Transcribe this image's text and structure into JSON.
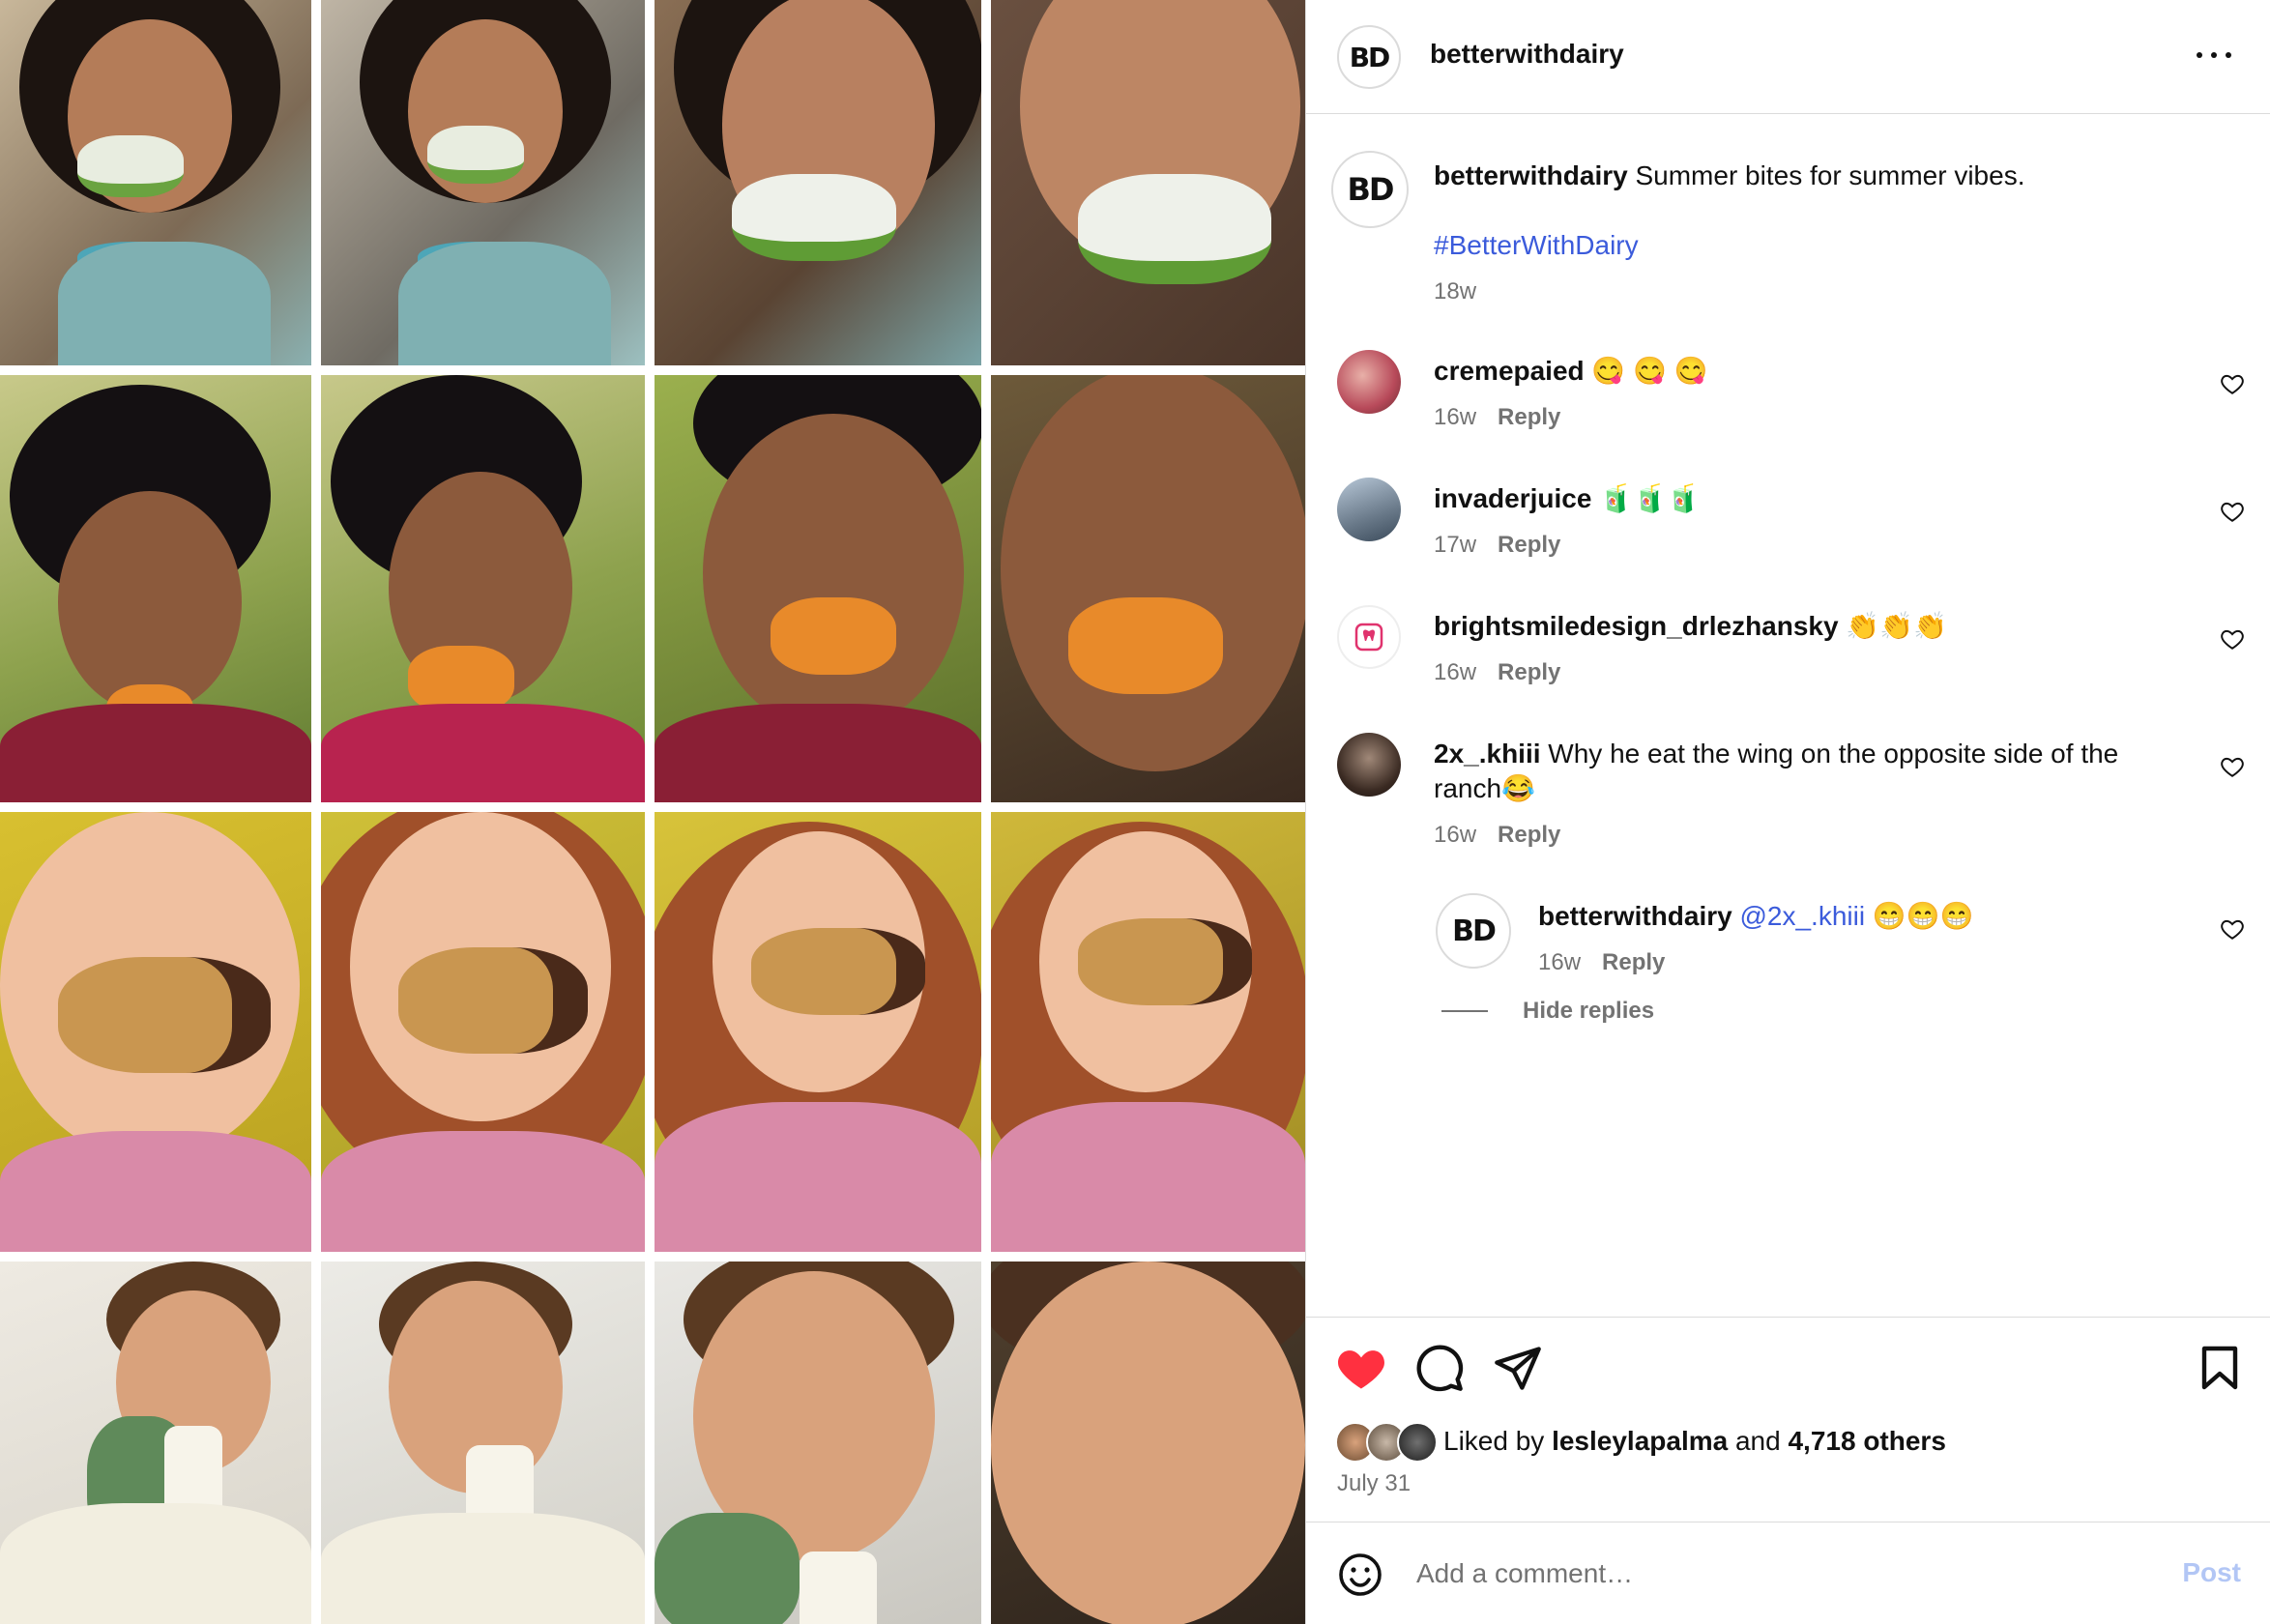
{
  "post": {
    "author": "betterwithdairy",
    "logo_text": "BD",
    "caption": {
      "author": "betterwithdairy",
      "text": "Summer bites for summer vibes.",
      "hashtag": "#BetterWithDairy",
      "age": "18w"
    }
  },
  "comments": [
    {
      "user": "cremepaied",
      "text": "😋 😋 😋",
      "age": "16w",
      "reply_label": "Reply"
    },
    {
      "user": "invaderjuice",
      "text": "🧃🧃🧃",
      "age": "17w",
      "reply_label": "Reply"
    },
    {
      "user": "brightsmiledesign_drlezhansky",
      "text": "👏👏👏",
      "age": "16w",
      "reply_label": "Reply"
    },
    {
      "user": "2x_.khiii",
      "text": "Why he eat the wing on the opposite side of the",
      "text2": "ranch😂",
      "age": "16w",
      "reply_label": "Reply"
    }
  ],
  "reply": {
    "user": "betterwithdairy",
    "mention": "@2x_.khiii",
    "text": "😁😁😁",
    "age": "16w",
    "reply_label": "Reply",
    "hide_replies": "Hide replies"
  },
  "likes": {
    "prefix": "Liked by",
    "user": "lesleylapalma",
    "and": "and",
    "others": "4,718 others",
    "date": "July 31"
  },
  "add_comment": {
    "placeholder": "Add a comment…",
    "post_label": "Post"
  },
  "colors": {
    "like_red": "#ff3040",
    "link_blue": "#3b5bdb",
    "post_disabled": "#b2c6f5"
  },
  "icons": [
    "more-icon",
    "heart-icon",
    "comment-icon",
    "share-icon",
    "bookmark-icon",
    "emoji-icon"
  ]
}
